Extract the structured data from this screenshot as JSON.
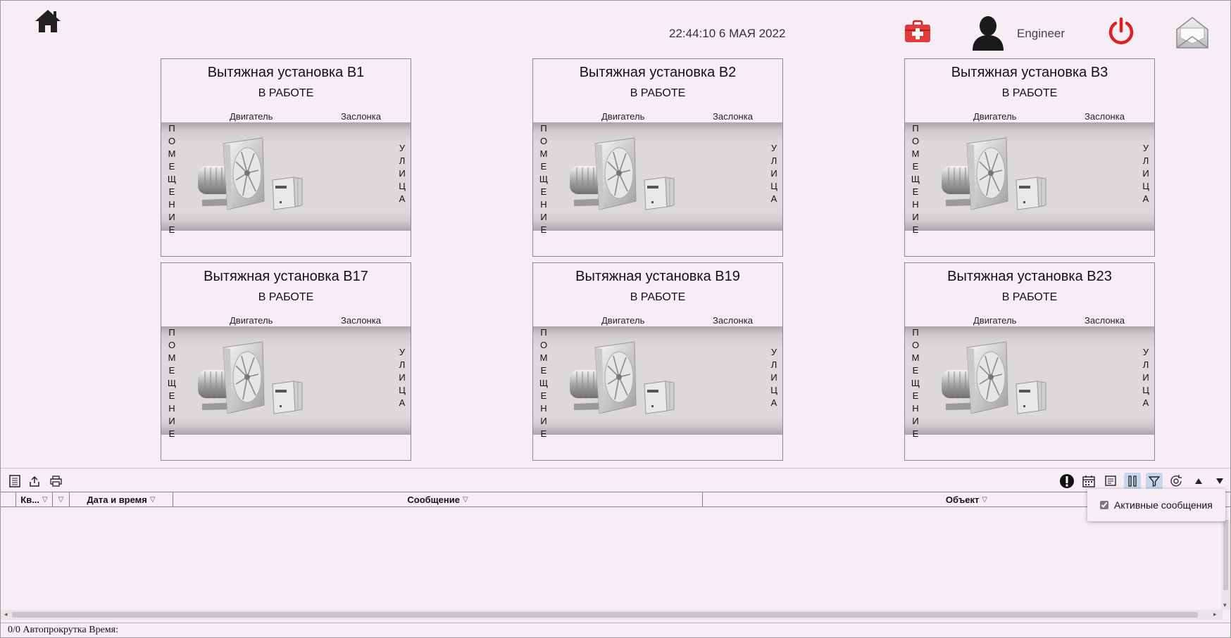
{
  "header": {
    "datetime": "22:44:10 6 МАЯ 2022",
    "user_name": "Engineer"
  },
  "card_labels": {
    "motor": "Двигатель",
    "damper": "Заслонка",
    "room": [
      "П",
      "О",
      "М",
      "Е",
      "Щ",
      "Е",
      "Н",
      "И",
      "Е"
    ],
    "street": [
      "У",
      "Л",
      "И",
      "Ц",
      "А"
    ]
  },
  "units": [
    {
      "title": "Вытяжная установка В1",
      "status": "В РАБОТЕ"
    },
    {
      "title": "Вытяжная установка В2",
      "status": "В РАБОТЕ"
    },
    {
      "title": "Вытяжная установка В3",
      "status": "В РАБОТЕ"
    },
    {
      "title": "Вытяжная установка В17",
      "status": "В РАБОТЕ"
    },
    {
      "title": "Вытяжная установка В19",
      "status": "В РАБОТЕ"
    },
    {
      "title": "Вытяжная установка В23",
      "status": "В РАБОТЕ"
    }
  ],
  "table": {
    "columns": [
      "Кв...",
      "",
      "Дата и время",
      "Сообщение",
      "Объект"
    ]
  },
  "popup": {
    "active_messages_label": "Активные сообщения",
    "active_messages_checked": true
  },
  "status_bar": "0/0 Автопрокрутка Время:",
  "icons": {
    "home": "home-icon",
    "medkit": "medkit-icon",
    "user": "user-icon",
    "power": "power-icon",
    "mail": "mail-icon"
  },
  "colors": {
    "background": "#f7eef5",
    "power": "#e0201f",
    "medkit": "#e33a3a",
    "active_toolbar": "#c6d6ec"
  }
}
